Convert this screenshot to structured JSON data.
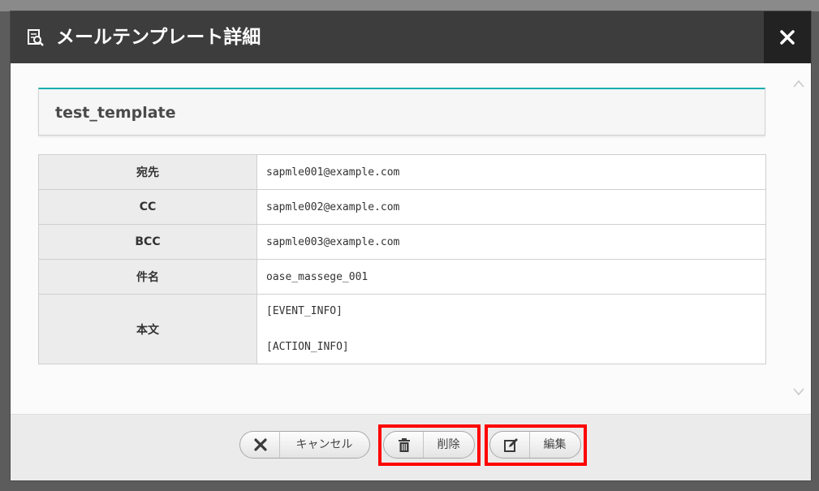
{
  "dialog": {
    "title": "メールテンプレート詳細",
    "header_icon": "document-search-icon",
    "close_icon": "close-icon",
    "template_name": "test_template"
  },
  "details": {
    "rows": [
      {
        "label": "宛先",
        "value": "sapmle001@example.com"
      },
      {
        "label": "CC",
        "value": "sapmle002@example.com"
      },
      {
        "label": "BCC",
        "value": "sapmle003@example.com"
      },
      {
        "label": "件名",
        "value": "oase_massege_001"
      }
    ],
    "body": {
      "label": "本文",
      "lines": [
        "[EVENT_INFO]",
        "[ACTION_INFO]"
      ]
    }
  },
  "footer": {
    "cancel": {
      "label": "キャンセル",
      "icon": "x-icon"
    },
    "delete": {
      "label": "削除",
      "icon": "trash-icon"
    },
    "edit": {
      "label": "編集",
      "icon": "edit-icon"
    }
  },
  "colors": {
    "header_bg": "#3d3d3d",
    "close_bg": "#222222",
    "accent": "#1aaeae",
    "highlight": "#ff0000"
  }
}
